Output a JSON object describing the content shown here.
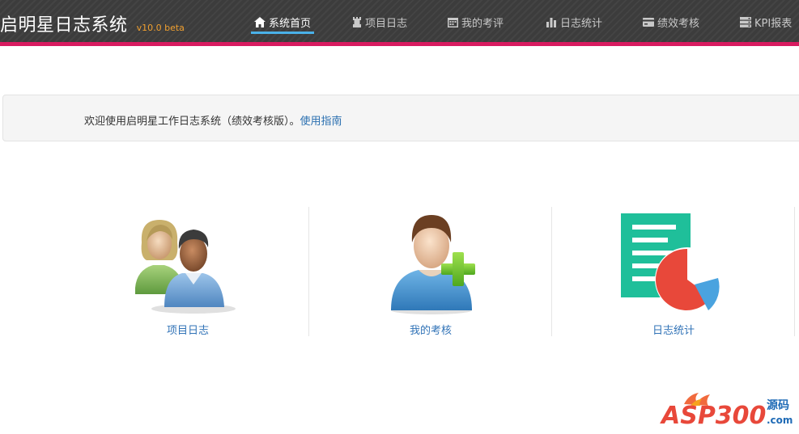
{
  "header": {
    "title": "启明星日志系统",
    "version": "v10.0 beta"
  },
  "nav": [
    {
      "label": "系统首页",
      "icon": "home-icon",
      "active": true
    },
    {
      "label": "项目日志",
      "icon": "rook-icon"
    },
    {
      "label": "我的考评",
      "icon": "calendar-icon"
    },
    {
      "label": "日志统计",
      "icon": "bar-chart-icon"
    },
    {
      "label": "绩效考核",
      "icon": "credit-card-icon"
    },
    {
      "label": "KPI报表",
      "icon": "server-icon"
    }
  ],
  "notice": {
    "text": "欢迎使用启明星工作日志系统（绩效考核版）。",
    "link": "使用指南"
  },
  "tiles": [
    {
      "label": "项目日志",
      "icon": "users-icon"
    },
    {
      "label": "我的考核",
      "icon": "add-user-icon"
    },
    {
      "label": "日志统计",
      "icon": "report-pie-chart-icon"
    }
  ],
  "watermark": {
    "text": "ASP300",
    "suffix": "源码",
    "domain": ".com"
  },
  "colors": {
    "topbar": "#3c3c3c",
    "accent_strip": "#d81b60",
    "active_underline": "#4ab1e8",
    "link": "#2a6fb0",
    "version": "#f0a030"
  }
}
